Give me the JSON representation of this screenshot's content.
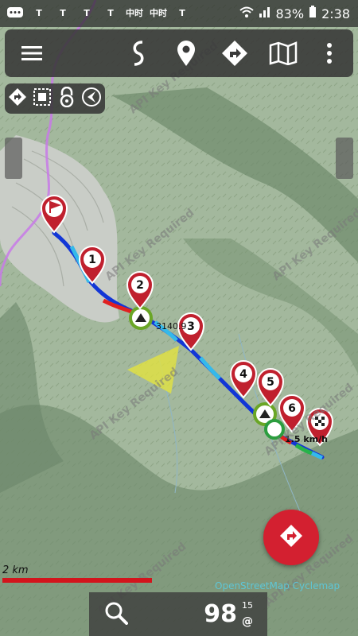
{
  "status_bar": {
    "left_icons": [
      "message-icon",
      "T-app-icon",
      "T-app-icon",
      "T-app-icon",
      "T-app-icon",
      "news-app-icon",
      "news-app-icon",
      "T-app-icon"
    ],
    "t_label": "T",
    "news_label": "中时",
    "battery": "83%",
    "time": "2:38"
  },
  "toolbar": {
    "icons": [
      "menu-icon",
      "route-icon",
      "location-pin-icon",
      "navigate-icon",
      "map-icon",
      "more-icon"
    ]
  },
  "quick_actions": {
    "icons": [
      "navigate-icon",
      "selection-icon",
      "lock-icon",
      "compass-icon"
    ]
  },
  "map": {
    "waypoints": [
      {
        "label": "1"
      },
      {
        "label": "2"
      },
      {
        "label": "3"
      },
      {
        "label": "4"
      },
      {
        "label": "5"
      },
      {
        "label": "6"
      }
    ],
    "elevation_label": "3140.9",
    "speed_label": "1.5 km/h",
    "watermark": "API Key Required",
    "colors": {
      "marker": "#c0202e",
      "track_blue": "#1236d6",
      "track_cyan": "#35b9ea",
      "track_red": "#e02020",
      "contour_purple": "#c879e8"
    }
  },
  "scale": {
    "label": "2 km"
  },
  "attribution": "OpenStreetMap Cyclemap",
  "bottom_bar": {
    "value": "98",
    "superscript": "15",
    "unit": "@"
  }
}
